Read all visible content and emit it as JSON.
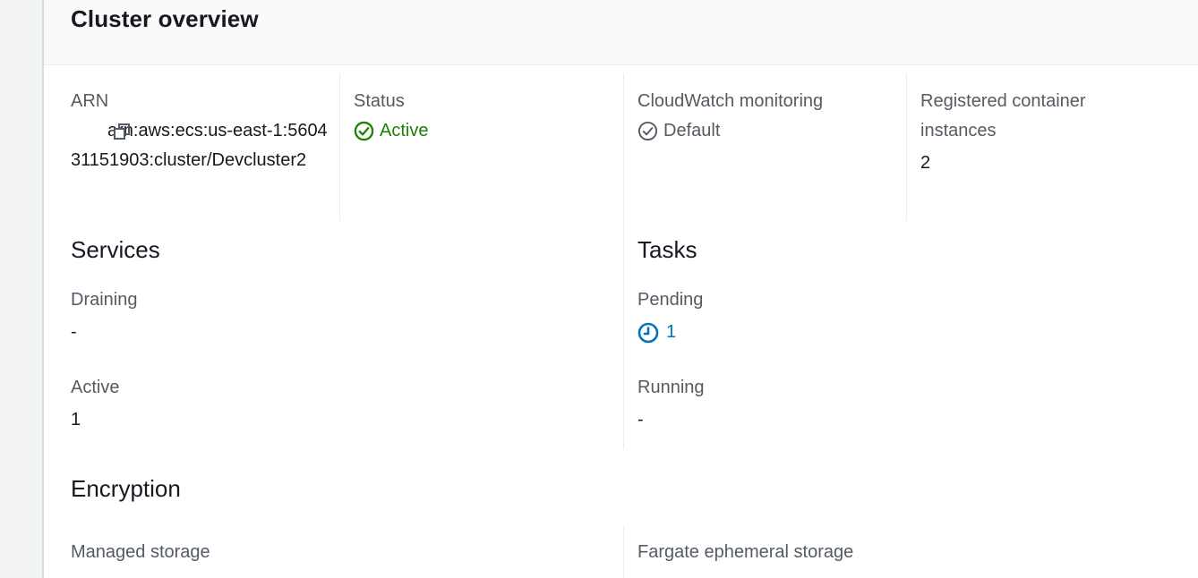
{
  "panel": {
    "title": "Cluster overview"
  },
  "overview": {
    "arn_label": "ARN",
    "arn_value": "arn:aws:ecs:us-east-1:560431151903:cluster/Devcluster2",
    "status_label": "Status",
    "status_value": "Active",
    "cloudwatch_label": "CloudWatch monitoring",
    "cloudwatch_value": "Default",
    "registered_label": "Registered container instances",
    "registered_value": "2"
  },
  "services": {
    "title": "Services",
    "draining_label": "Draining",
    "draining_value": "-",
    "active_label": "Active",
    "active_value": "1"
  },
  "tasks": {
    "title": "Tasks",
    "pending_label": "Pending",
    "pending_value": "1",
    "running_label": "Running",
    "running_value": "-"
  },
  "encryption": {
    "title": "Encryption",
    "managed_storage_label": "Managed storage",
    "fargate_storage_label": "Fargate ephemeral storage"
  },
  "colors": {
    "success": "#1d8102",
    "link": "#0073bb",
    "muted": "#545b64",
    "text": "#16191f"
  },
  "icons": {
    "copy": "copy-icon",
    "status_active": "check-circle-icon",
    "cloudwatch_default": "check-circle-outline-icon",
    "pending": "clock-icon"
  }
}
